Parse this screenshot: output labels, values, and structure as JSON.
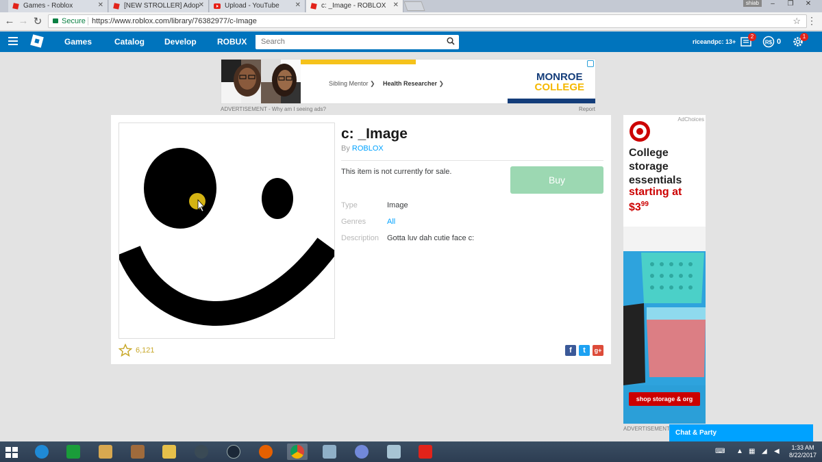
{
  "browser": {
    "tabs": [
      {
        "title": "Games - Roblox"
      },
      {
        "title": "[NEW STROLLER] Adopt"
      },
      {
        "title": "Upload - YouTube"
      },
      {
        "title": "c: _Image - ROBLOX"
      }
    ],
    "user_chip": "shiab",
    "secure_label": "Secure",
    "url": "https://www.roblox.com/library/76382977/c-Image",
    "bookmark_icon": "star-outline-icon"
  },
  "nav": {
    "links": [
      "Games",
      "Catalog",
      "Develop",
      "ROBUX"
    ],
    "search_placeholder": "Search",
    "username": "riceandpc: 13+",
    "messages_badge": "2",
    "robux_amount": "0",
    "settings_badge": "1"
  },
  "top_ad": {
    "links": [
      "Sibling Mentor",
      "Health Researcher"
    ],
    "brand_line1": "MONROE",
    "brand_line2": "COLLEGE",
    "caption": "ADVERTISEMENT - Why am I seeing ads?",
    "report": "Report"
  },
  "item": {
    "title": "c: _Image",
    "by_prefix": "By",
    "creator": "ROBLOX",
    "sale_status": "This item is not currently for sale.",
    "buy_label": "Buy",
    "details": [
      {
        "label": "Type",
        "value": "Image"
      },
      {
        "label": "Genres",
        "value": "All"
      },
      {
        "label": "Description",
        "value": "Gotta luv dah cutie face c:"
      }
    ],
    "favorites": "6,121",
    "share": [
      "f",
      "t",
      "g+"
    ]
  },
  "side_ad": {
    "adchoices": "AdChoices",
    "headline": "College storage essentials",
    "price_line1": "starting at",
    "price_line2": "$3",
    "price_cents": "99",
    "cta": "shop storage & org",
    "caption": "ADVERTISEMENT"
  },
  "chat": {
    "label": "Chat & Party"
  },
  "taskbar": {
    "time": "1:33 AM",
    "date": "8/22/2017"
  },
  "colors": {
    "roblox_blue": "#0074bd",
    "link_blue": "#00a2ff",
    "buy_disabled": "#9cd8b2",
    "target_red": "#cc0000"
  }
}
